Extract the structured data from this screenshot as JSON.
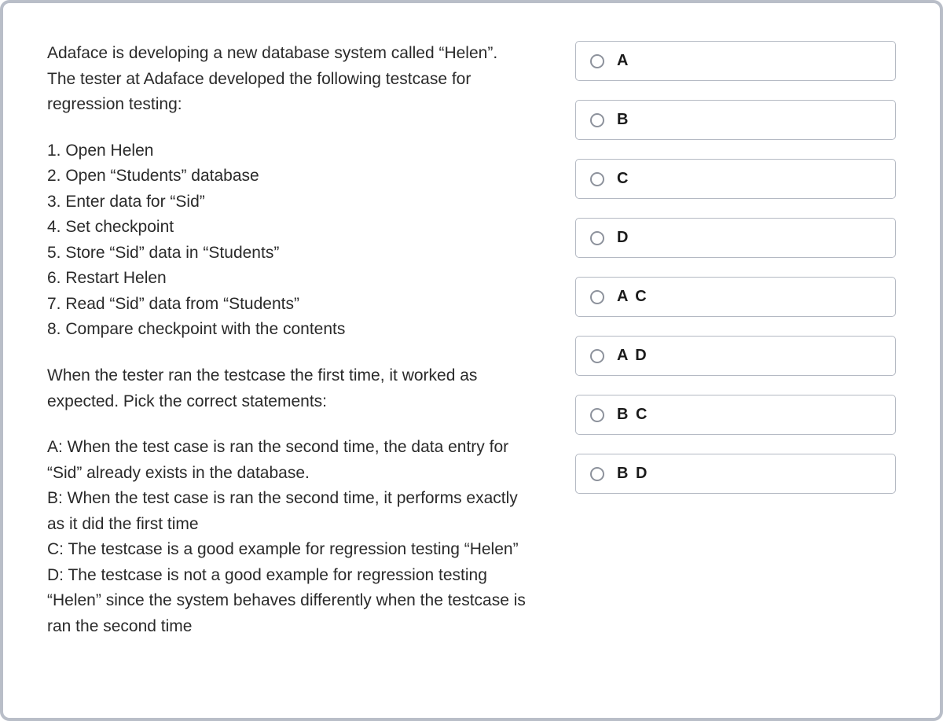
{
  "question": {
    "intro": "Adaface is developing a new database system called “Helen”. The tester at Adaface developed the following testcase for regression testing:",
    "steps": [
      "1. Open Helen",
      "2. Open “Students” database",
      "3. Enter data for “Sid”",
      "4. Set checkpoint",
      "5. Store “Sid” data in “Students”",
      "6. Restart Helen",
      "7. Read “Sid” data from “Students”",
      "8. Compare checkpoint with the contents"
    ],
    "prompt": "When the tester ran the testcase the first time, it worked as expected. Pick the correct statements:",
    "statements": "A: When the test case is ran the second time, the data entry for “Sid” already exists in the database.\nB: When the test case is ran the second time, it performs exactly as it did the first time\nC: The testcase is a good example for regression testing “Helen”\nD: The testcase is not a good example for regression testing “Helen” since the system behaves differently when the testcase is ran the second time"
  },
  "options": [
    {
      "label": "A"
    },
    {
      "label": "B"
    },
    {
      "label": "C"
    },
    {
      "label": "D"
    },
    {
      "label": "A C"
    },
    {
      "label": "A D"
    },
    {
      "label": "B C"
    },
    {
      "label": "B D"
    }
  ]
}
